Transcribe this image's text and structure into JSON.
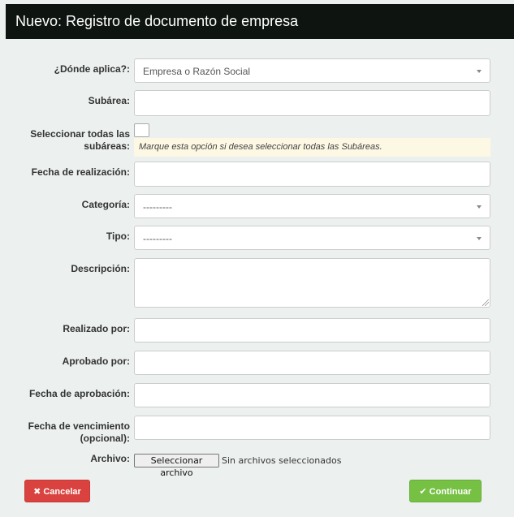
{
  "header": {
    "title": "Nuevo: Registro de documento de empresa"
  },
  "form": {
    "aplica": {
      "label": "¿Dónde aplica?:",
      "value": "Empresa o Razón Social"
    },
    "subarea": {
      "label": "Subárea:",
      "value": ""
    },
    "select_all": {
      "label_line1": "Seleccionar todas las",
      "label_line2": "subáreas:",
      "checked": false,
      "help": "Marque esta opción si desea seleccionar todas las Subáreas."
    },
    "fecha_realizacion": {
      "label": "Fecha de realización:",
      "value": ""
    },
    "categoria": {
      "label": "Categoría:",
      "value": "---------"
    },
    "tipo": {
      "label": "Tipo:",
      "value": "---------"
    },
    "descripcion": {
      "label": "Descripción:",
      "value": ""
    },
    "realizado_por": {
      "label": "Realizado por:",
      "value": ""
    },
    "aprobado_por": {
      "label": "Aprobado por:",
      "value": ""
    },
    "fecha_aprobacion": {
      "label": "Fecha de aprobación:",
      "value": ""
    },
    "fecha_vencimiento": {
      "label_line1": "Fecha de vencimiento",
      "label_line2": "(opcional):",
      "value": ""
    },
    "archivo": {
      "label": "Archivo:",
      "button_label": "Seleccionar archivo",
      "status": "Sin archivos seleccionados"
    }
  },
  "actions": {
    "cancel": {
      "label": "Cancelar",
      "icon": "close-icon",
      "color": "#d9423f"
    },
    "continue": {
      "label": "Continuar",
      "icon": "check-icon",
      "color": "#76c043"
    }
  }
}
